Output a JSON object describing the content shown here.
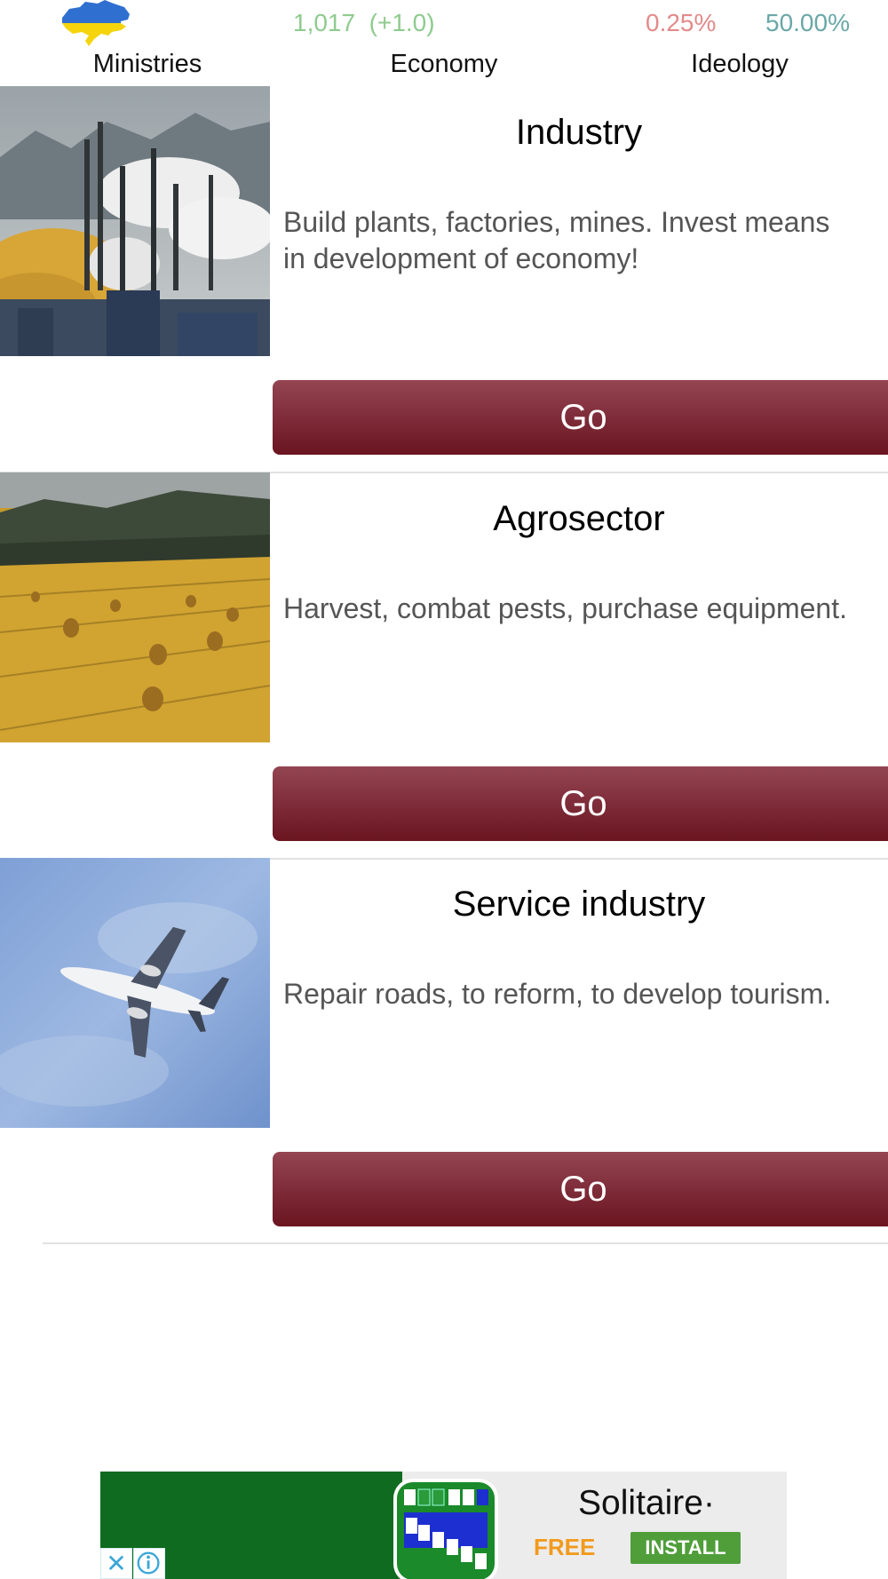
{
  "header": {
    "tabs": [
      {
        "label": "Ministries"
      },
      {
        "label": "Economy"
      },
      {
        "label": "Ideology"
      }
    ],
    "stats": {
      "money": "1,017",
      "money_change": "(+1.0)",
      "stat_a": "0.25%",
      "stat_b": "50.00%"
    },
    "icon": "ukraine-map-icon"
  },
  "sections": [
    {
      "title": "Industry",
      "description": "Build plants, factories, mines. Invest means in development of economy!",
      "button": "Go",
      "image": "industry-photo"
    },
    {
      "title": "Agrosector",
      "description": "Harvest, combat pests, purchase equipment.",
      "button": "Go",
      "image": "hay-field-photo"
    },
    {
      "title": "Service industry",
      "description": "Repair roads, to reform, to develop tourism.",
      "button": "Go",
      "image": "airplane-photo"
    }
  ],
  "ad": {
    "title": "Solitaire·",
    "price": "FREE",
    "install": "INSTALL",
    "close_glyph": "✕"
  },
  "colors": {
    "button_top": "#944552",
    "button_bottom": "#6a1520",
    "money_green": "#8fcb8f",
    "stat_red": "#e38a8a",
    "stat_teal": "#6aa7a7"
  }
}
